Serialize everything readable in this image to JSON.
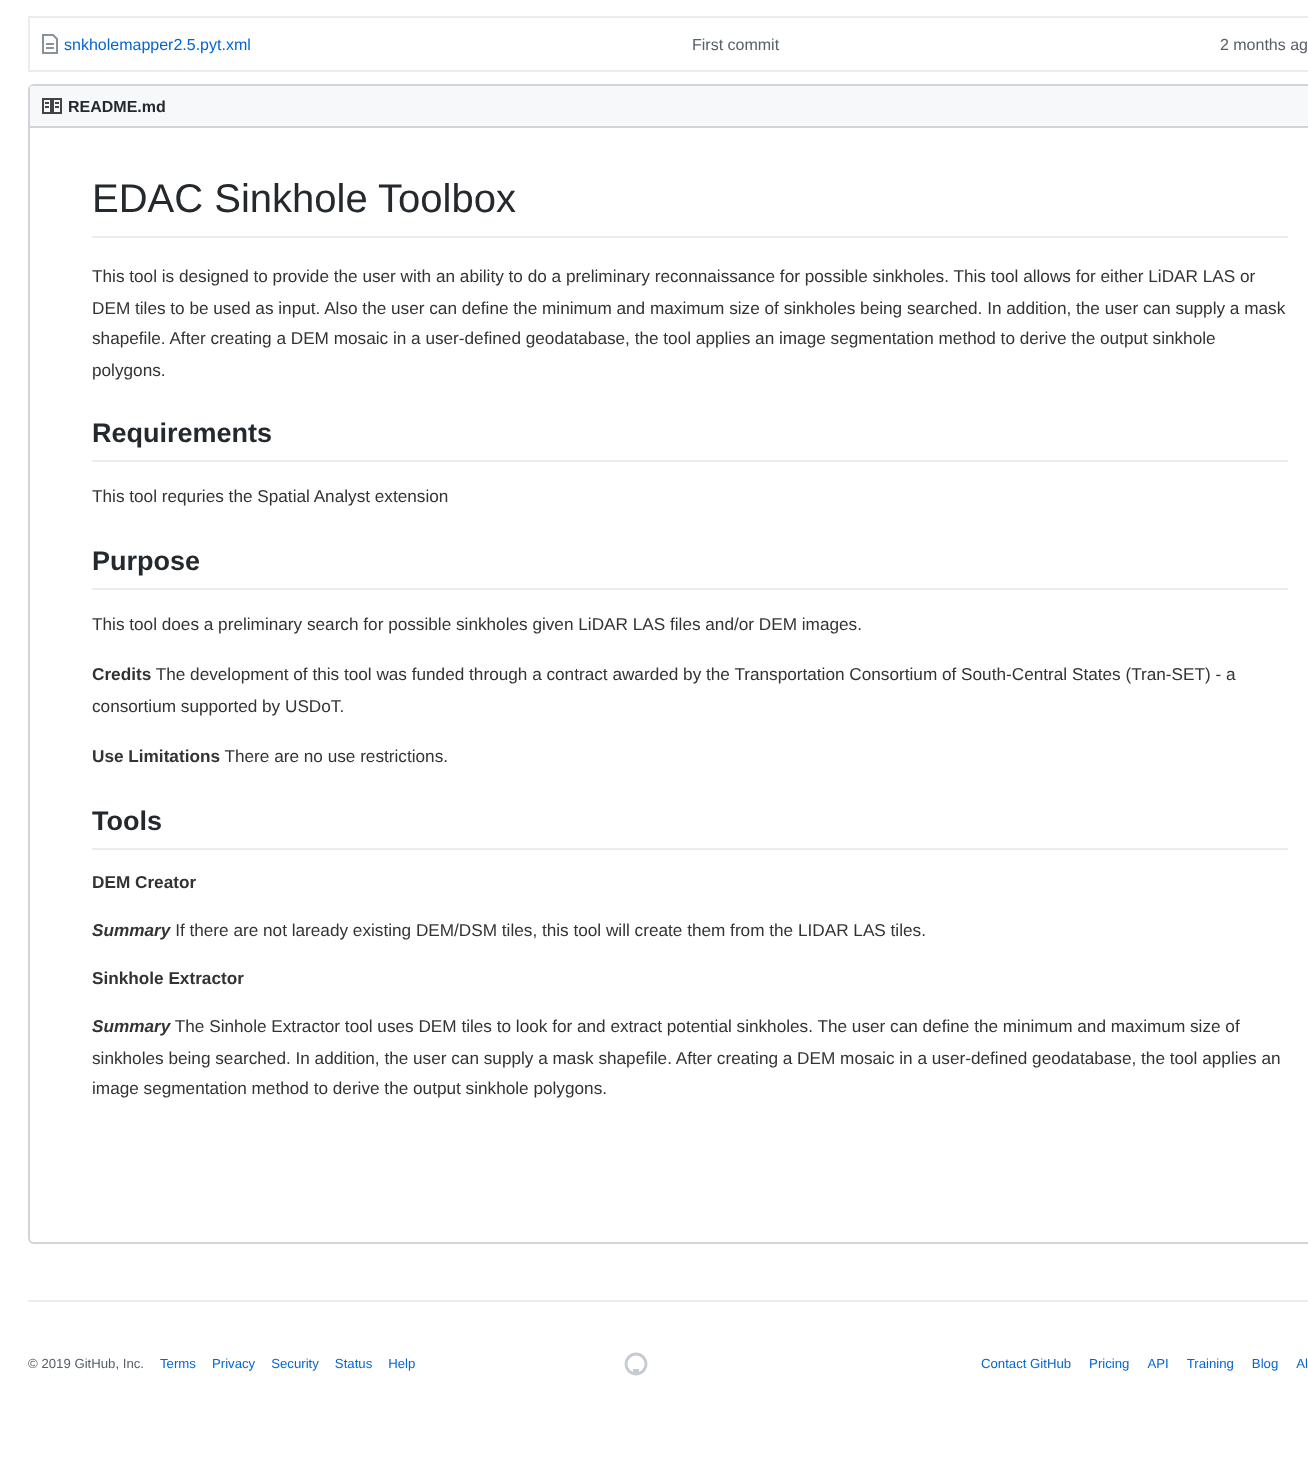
{
  "file_row": {
    "name": "snkholemapper2.5.pyt.xml",
    "commit_message": "First commit",
    "age": "2 months ag"
  },
  "readme": {
    "filename": "README.md",
    "title": "EDAC Sinkhole Toolbox",
    "intro": "This tool is designed to provide the user with an ability to do a preliminary reconnaissance for possible sinkholes. This tool allows for either LiDAR LAS or DEM tiles to be used as input. Also the user can define the minimum and maximum size of sinkholes being searched. In addition, the user can supply a mask shapefile. After creating a DEM mosaic in a user-defined geodatabase, the tool applies an image segmentation method to derive the output sinkhole polygons.",
    "sections": [
      {
        "heading": "Requirements",
        "blocks": [
          {
            "kind": "paragraph",
            "text": "This tool requries the Spatial Analyst extension"
          }
        ]
      },
      {
        "heading": "Purpose",
        "blocks": [
          {
            "kind": "paragraph",
            "text": "This tool does a preliminary search for possible sinkholes given LiDAR LAS files and/or DEM images."
          },
          {
            "kind": "paragraph",
            "text": "**Credits** The development of this tool was funded through a contract awarded by the Transportation Consortium of South-Central States (Tran-SET) - a consortium supported by USDoT."
          },
          {
            "kind": "paragraph",
            "text": "**Use Limitations** There are no use restrictions."
          }
        ]
      },
      {
        "heading": "Tools",
        "blocks": [
          {
            "kind": "subheading",
            "text": "DEM Creator"
          },
          {
            "kind": "summary",
            "label": "Summary",
            "text": "If there are not laready existing DEM/DSM tiles, this tool will create them from the LIDAR LAS tiles."
          },
          {
            "kind": "subheading",
            "text": "Sinkhole Extractor"
          },
          {
            "kind": "summary",
            "label": "Summary",
            "text": "The Sinhole Extractor tool uses DEM tiles to look for and extract potential sinkholes. The user can define the minimum and maximum size of sinkholes being searched. In addition, the user can supply a mask shapefile. After creating a DEM mosaic in a user-defined geodatabase, the tool applies an image segmentation method to derive the output sinkhole polygons."
          }
        ]
      }
    ]
  },
  "footer": {
    "copyright": "© 2019 GitHub, Inc.",
    "left_links": [
      "Terms",
      "Privacy",
      "Security",
      "Status",
      "Help"
    ],
    "right_links": [
      "Contact GitHub",
      "Pricing",
      "API",
      "Training",
      "Blog",
      "Al"
    ]
  }
}
